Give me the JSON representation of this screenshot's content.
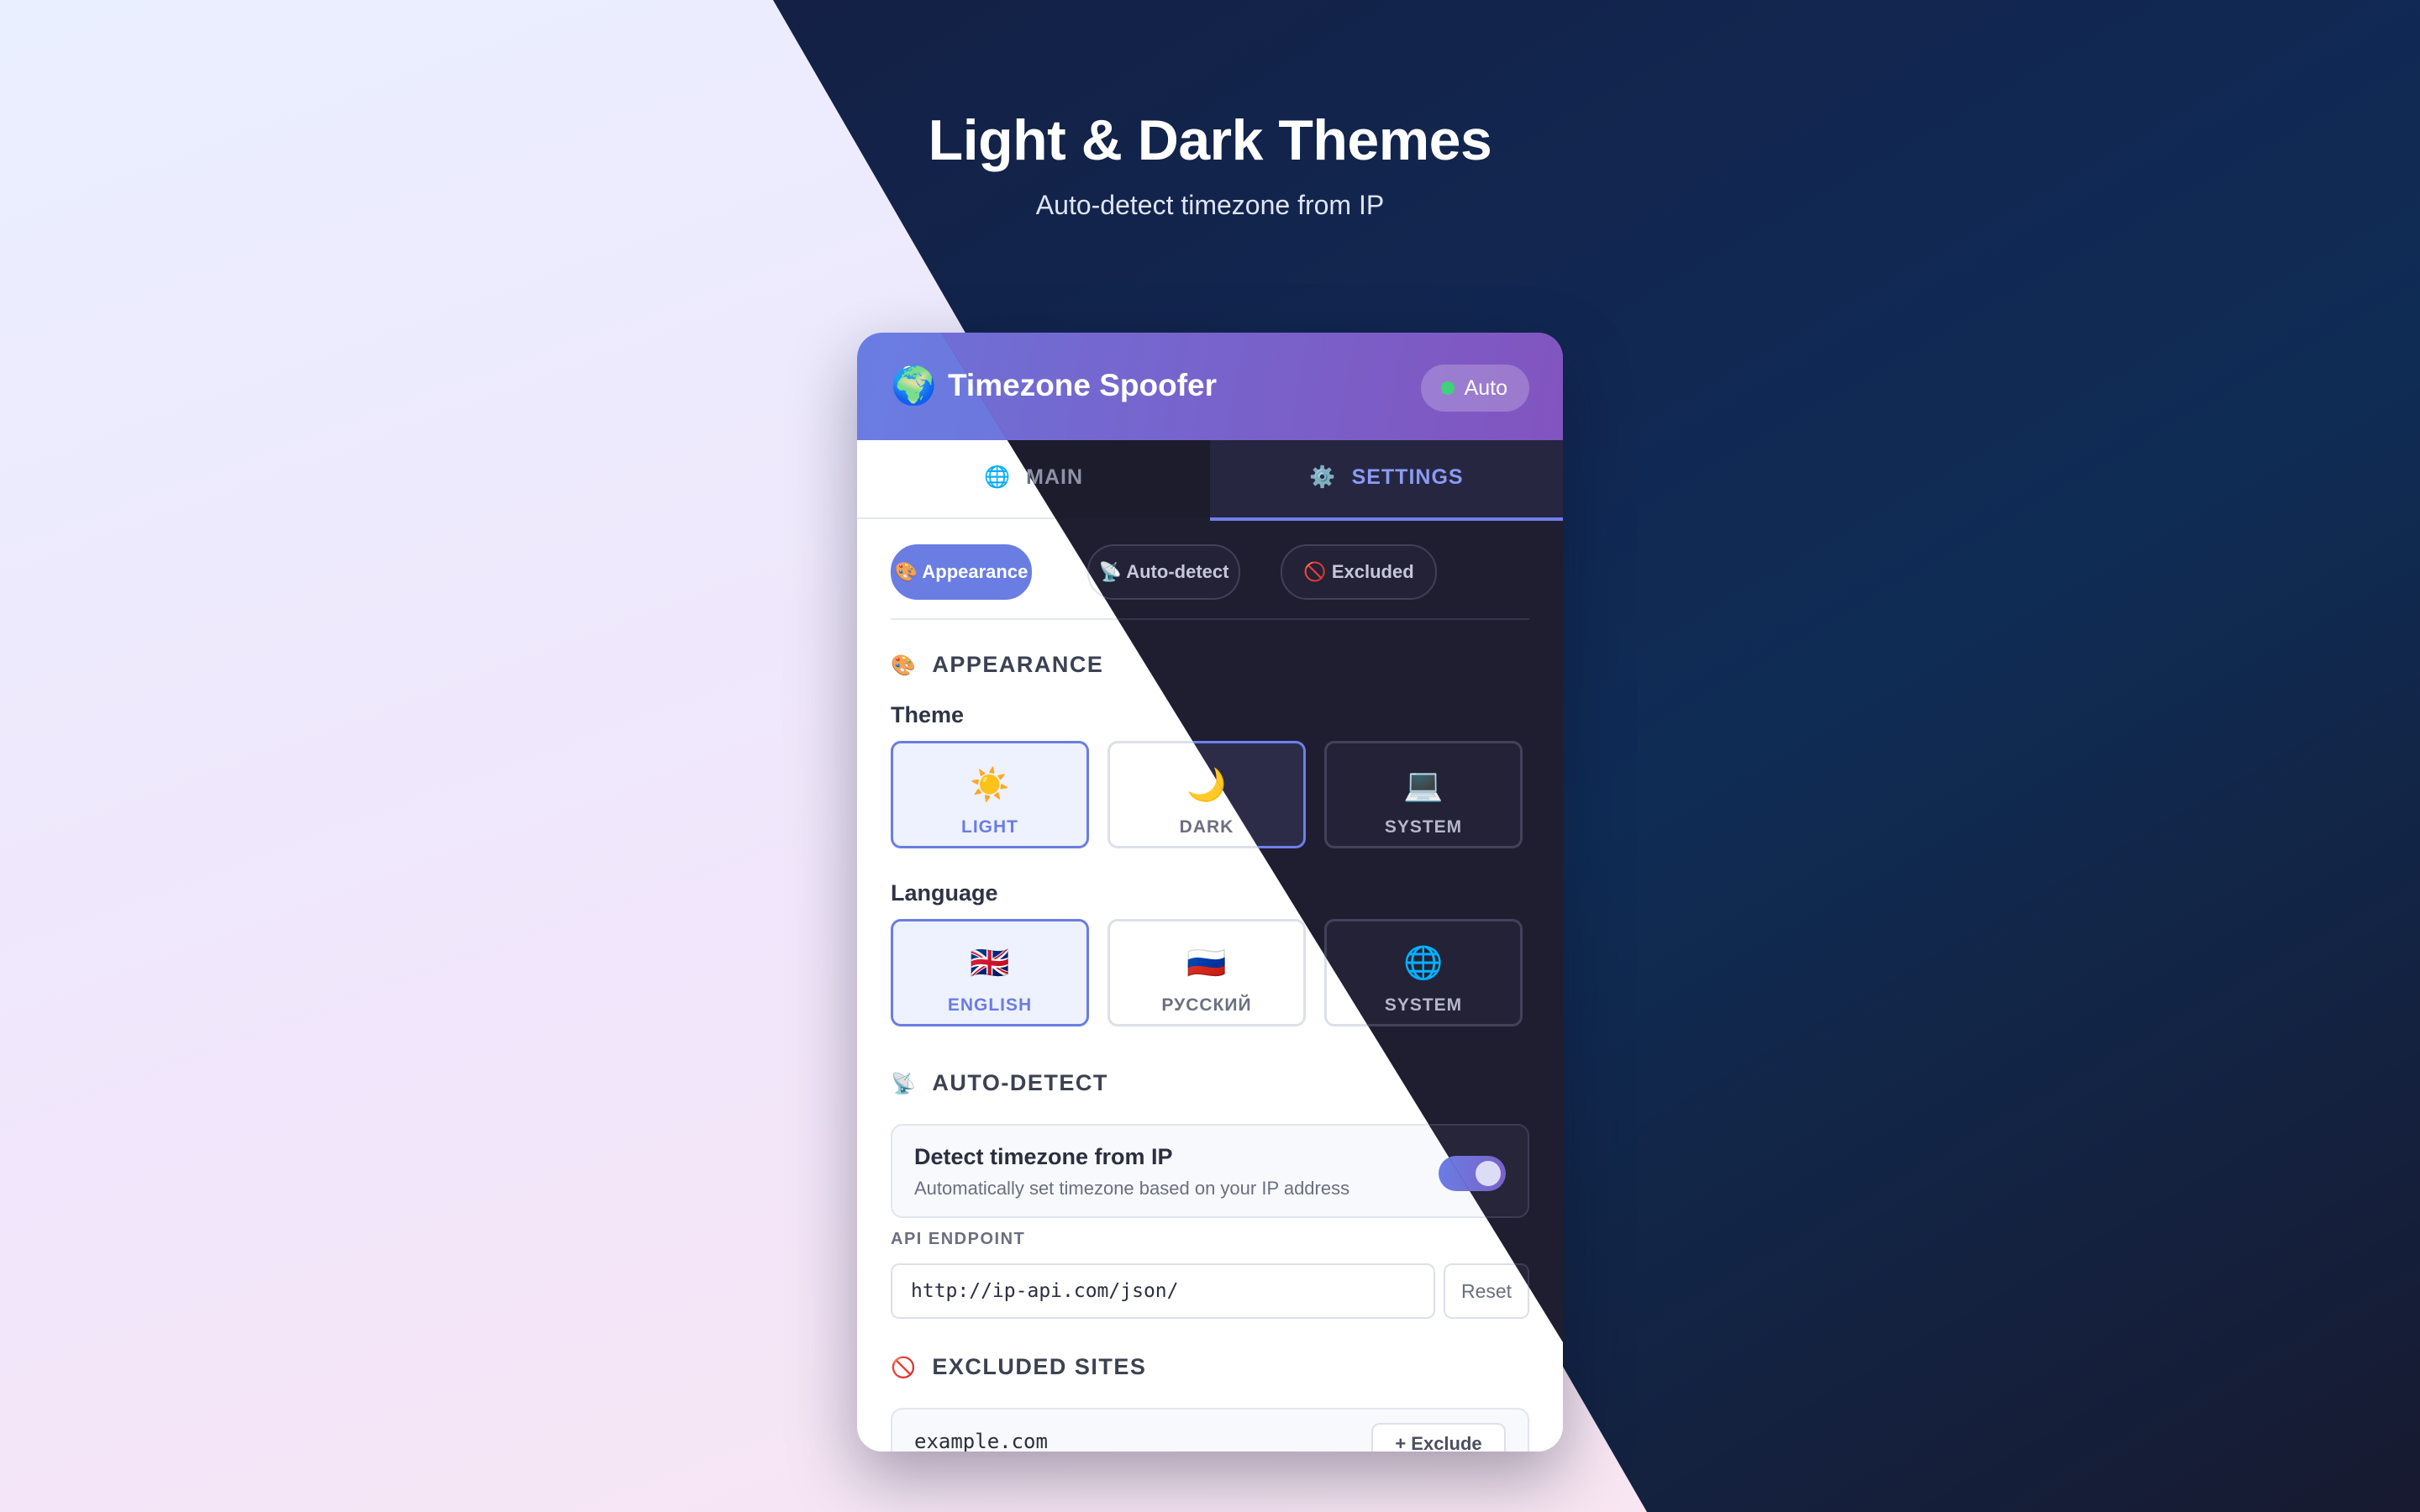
{
  "hero": {
    "title": "Light & Dark Themes",
    "subtitle": "Auto-detect timezone from IP"
  },
  "header": {
    "logo_icon": "globe-europe-africa-icon",
    "logo_glyph": "🌍",
    "title": "Timezone Spoofer",
    "status_label": "Auto",
    "status_color": "#3ed37a"
  },
  "tabs": {
    "main": {
      "label": "MAIN",
      "icon": "🌐"
    },
    "settings": {
      "label": "SETTINGS",
      "icon": "⚙️"
    }
  },
  "subtabs": {
    "appearance": {
      "label": "Appearance",
      "icon": "🎨"
    },
    "autodetect": {
      "label": "Auto-detect",
      "icon": "📡"
    },
    "excluded": {
      "label": "Excluded",
      "icon": "🚫"
    }
  },
  "appearance": {
    "heading": "APPEARANCE",
    "icon": "🎨",
    "theme_label": "Theme",
    "theme_options": [
      {
        "label": "LIGHT",
        "emoji": "☀️",
        "selected": true
      },
      {
        "label": "DARK",
        "emoji": "🌙",
        "selected": true
      },
      {
        "label": "SYSTEM",
        "emoji": "💻",
        "selected": false
      }
    ],
    "language_label": "Language",
    "language_options": [
      {
        "label": "ENGLISH",
        "emoji": "🇬🇧",
        "selected": true
      },
      {
        "label": "РУССКИЙ",
        "emoji": "🇷🇺",
        "selected": false
      },
      {
        "label": "SYSTEM",
        "emoji": "🌐",
        "selected": false
      }
    ]
  },
  "autodetect": {
    "heading": "AUTO-DETECT",
    "icon": "📡",
    "toggle_title": "Detect timezone from IP",
    "toggle_desc": "Automatically set timezone based on your IP address",
    "toggle_on": true,
    "api_label": "API ENDPOINT",
    "api_value": "http://ip-api.com/json/",
    "reset_label": "Reset"
  },
  "excluded": {
    "heading": "EXCLUDED SITES",
    "icon": "🚫",
    "site_value": "example.com",
    "exclude_button": "+ Exclude"
  },
  "colors": {
    "accent": "#6a7de3",
    "accent_secondary": "#7a62c9",
    "dark_panel": "#1f1e30"
  }
}
